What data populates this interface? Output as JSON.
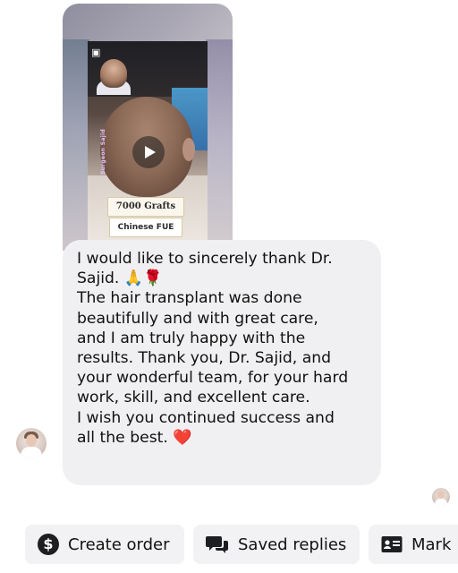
{
  "video": {
    "caption_grafts": "7000 Grafts",
    "caption_method": "Chinese FUE",
    "side_label": "Surgeon Sajid"
  },
  "message": {
    "text": "I would like to sincerely thank Dr.\nSajid. 🙏🌹\nThe hair transplant was done\nbeautifully and with great care,\nand I am truly happy with the\nresults. Thank you, Dr. Sajid, and\nyour wonderful team, for your hard\nwork, skill, and excellent care.\nI wish you continued success and\nall the best. ❤️"
  },
  "actions": {
    "create_order": "Create order",
    "saved_replies": "Saved replies",
    "mark": "Mark"
  },
  "colors": {
    "bubble": "#f0f0f2",
    "chip": "#f2f2f4",
    "text": "#111111"
  },
  "icons": {
    "create_order": "dollar-circle-icon",
    "saved_replies": "chat-bubbles-icon",
    "mark": "id-card-icon",
    "video": "play-icon"
  }
}
